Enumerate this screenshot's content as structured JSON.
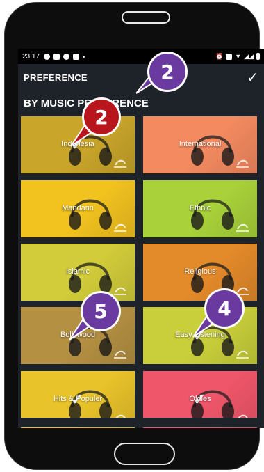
{
  "status": {
    "time": "23.17"
  },
  "appbar": {
    "title": "PREFERENCE",
    "check_icon": "checkmark-icon"
  },
  "section": {
    "title": "BY MUSIC PREFERENCE"
  },
  "tiles": [
    {
      "label": "Indonesia",
      "selected": true,
      "color": "#c9a52a"
    },
    {
      "label": "International",
      "selected": false,
      "color": "#f38a60"
    },
    {
      "label": "Mandarin",
      "selected": false,
      "color": "#f2c21f"
    },
    {
      "label": "Ethnic",
      "selected": false,
      "color": "#a9d23a"
    },
    {
      "label": "Islamic",
      "selected": false,
      "color": "#d2cc3a"
    },
    {
      "label": "Religious",
      "selected": false,
      "color": "#e38a2a"
    },
    {
      "label": "Bollywood",
      "selected": false,
      "color": "#b49042"
    },
    {
      "label": "Easy Listening",
      "selected": true,
      "color": "#c9cf3a"
    },
    {
      "label": "Hits & Populer",
      "selected": true,
      "color": "#e9c32a"
    },
    {
      "label": "Oldies",
      "selected": true,
      "color": "#f0566a"
    }
  ],
  "badges": {
    "top": "2",
    "indonesia": "2",
    "bollywood": "5",
    "easy_listening": "4"
  }
}
